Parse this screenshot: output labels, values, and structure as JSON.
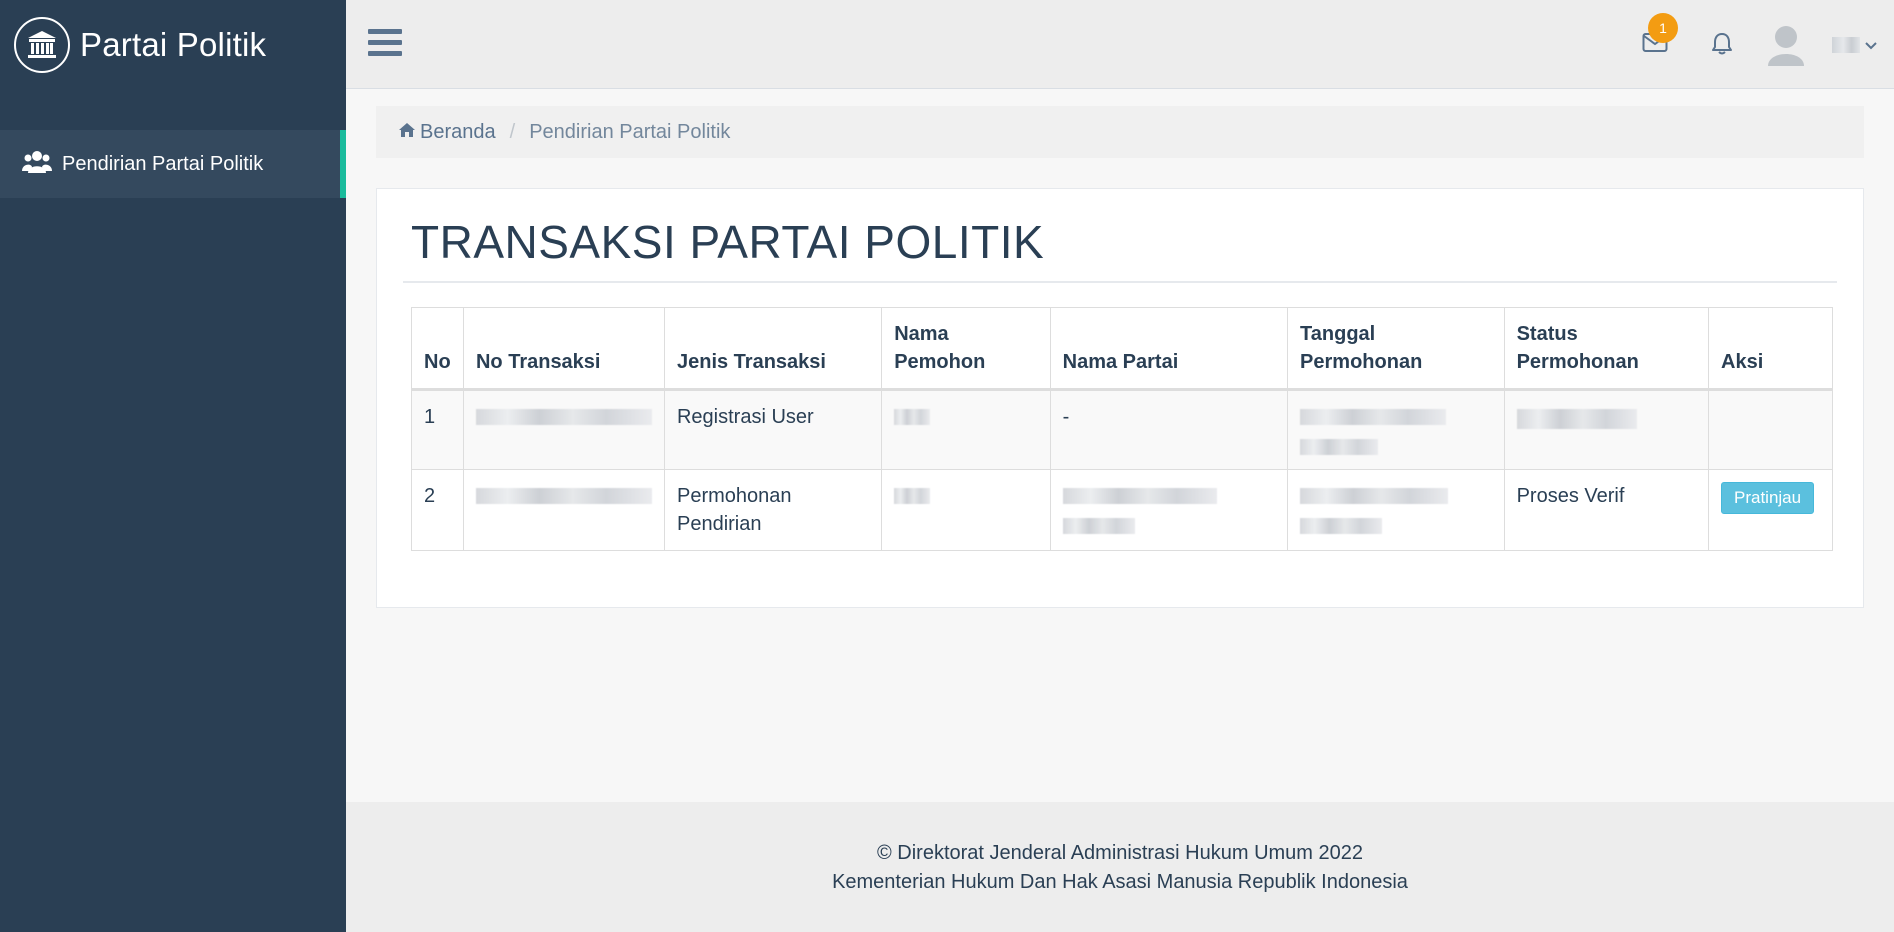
{
  "app": {
    "title": "Partai Politik"
  },
  "sidebar": {
    "items": [
      {
        "label": "Pendirian Partai Politik",
        "icon": "users-icon",
        "active": true
      }
    ]
  },
  "topbar": {
    "mail_badge": "1",
    "icons": [
      "menu-icon",
      "envelope-icon",
      "bell-icon",
      "user-avatar",
      "chevron-down-icon"
    ]
  },
  "breadcrumb": {
    "home": "Beranda",
    "current": "Pendirian Partai Politik"
  },
  "panel": {
    "title": "TRANSAKSI PARTAI POLITIK",
    "table": {
      "headers": {
        "no": "No",
        "no_transaksi": "No Transaksi",
        "jenis_transaksi": "Jenis Transaksi",
        "nama_pemohon": "Nama Pemohon",
        "nama_partai": "Nama Partai",
        "tanggal_permohonan": "Tanggal Permohonan",
        "status_permohonan": "Status Permohonan",
        "aksi": "Aksi"
      },
      "rows": [
        {
          "no": "1",
          "jenis_transaksi": "Registrasi User",
          "nama_partai": "-"
        },
        {
          "no": "2",
          "jenis_transaksi": "Permohonan Pendirian",
          "status_permohonan": "Proses Verif",
          "aksi": "Pratinjau"
        }
      ]
    }
  },
  "footer": {
    "line1": "© Direktorat Jenderal Administrasi Hukum Umum 2022",
    "line2": "Kementerian Hukum Dan Hak Asasi Manusia Republik Indonesia"
  },
  "colors": {
    "sidebar_bg": "#2a3f54",
    "active_indicator": "#1abb9c",
    "badge": "#f39c12",
    "button_info": "#5bc0de"
  }
}
